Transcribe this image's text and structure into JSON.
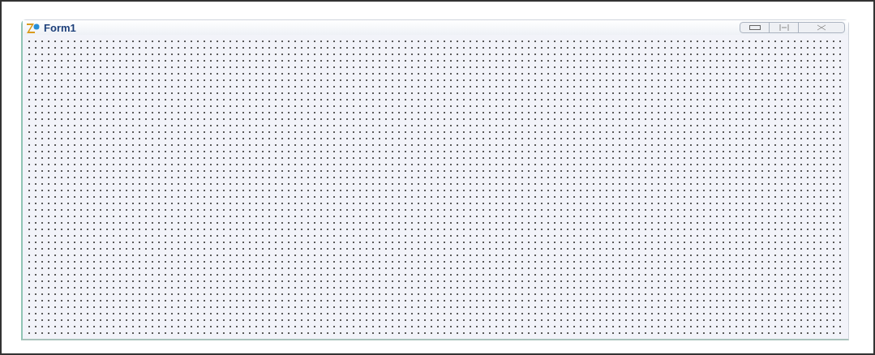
{
  "window": {
    "title": "Form1"
  }
}
